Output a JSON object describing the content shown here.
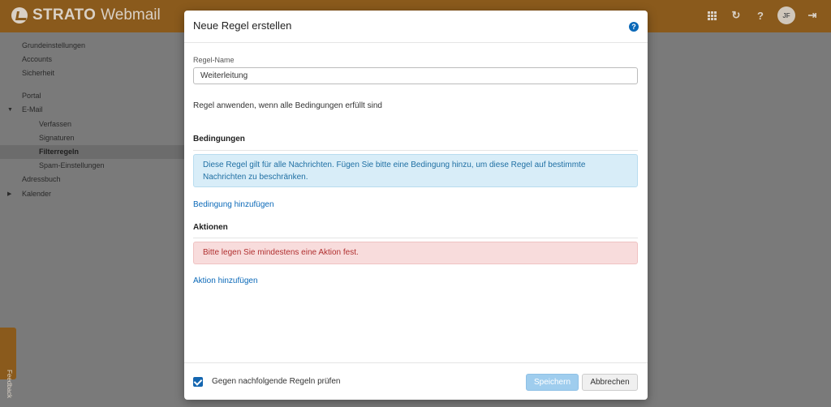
{
  "header": {
    "brand": "STRATO",
    "product": "Webmail",
    "avatar_initials": "JF",
    "icons": [
      "apps-grid-icon",
      "refresh-icon",
      "help-icon",
      "user-avatar",
      "logout-icon"
    ]
  },
  "sidebar": {
    "items": [
      {
        "label": "Grundeinstellungen"
      },
      {
        "label": "Accounts"
      },
      {
        "label": "Sicherheit"
      },
      {
        "label": "Portal"
      },
      {
        "label": "E-Mail"
      },
      {
        "label": "Verfassen"
      },
      {
        "label": "Signaturen"
      },
      {
        "label": "Filterregeln"
      },
      {
        "label": "Spam-Einstellungen"
      },
      {
        "label": "Adressbuch"
      },
      {
        "label": "Kalender"
      }
    ],
    "active": "Filterregeln",
    "feedback_label": "Feedback"
  },
  "modal": {
    "title": "Neue Regel erstellen",
    "name_label": "Regel-Name",
    "name_value": "Weiterleitung",
    "apply_text": "Regel anwenden, wenn alle Bedingungen erfüllt sind",
    "conditions_heading": "Bedingungen",
    "conditions_info": "Diese Regel gilt für alle Nachrichten. Fügen Sie bitte eine Bedingung hinzu, um diese Regel auf bestimmte Nachrichten zu beschränken.",
    "add_condition": "Bedingung hinzufügen",
    "actions_heading": "Aktionen",
    "actions_error": "Bitte legen Sie mindestens eine Aktion fest.",
    "add_action": "Aktion hinzufügen",
    "check_label": "Gegen nachfolgende Regeln prüfen",
    "check_checked": true,
    "save_label": "Speichern",
    "cancel_label": "Abbrechen"
  },
  "colors": {
    "header_bg": "#8a5a1c",
    "overlay": "#7a7a7a",
    "link": "#0b69b8",
    "info_bg": "#d8edf8",
    "danger_bg": "#f8dcdc",
    "primary_disabled": "#9fcdee"
  }
}
